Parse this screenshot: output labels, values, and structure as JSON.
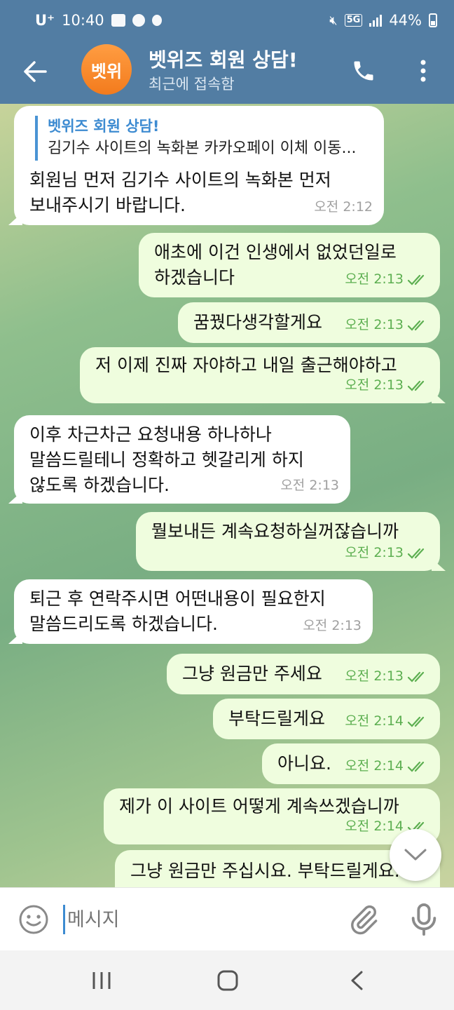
{
  "status_bar": {
    "carrier": "U⁺",
    "time": "10:40",
    "network": "5G",
    "battery": "44%"
  },
  "header": {
    "avatar_text": "벳위",
    "title": "벳위즈 회원 상담!",
    "subtitle": "최근에 접속함"
  },
  "messages": [
    {
      "dir": "in",
      "reply_name": "벳위즈 회원 상담!",
      "reply_text": "김기수 사이트의 녹화본  카카오페이 이체 이동...",
      "lines": [
        "회원님 먼저 김기수 사이트의 녹화본 먼저",
        "보내주시기 바랍니다."
      ],
      "time": "오전 2:12"
    },
    {
      "dir": "out",
      "lines": [
        "애초에 이건 인생에서 없었던일로",
        "하겠습니다"
      ],
      "time": "오전 2:13"
    },
    {
      "dir": "out",
      "lines": [
        "꿈꿨다생각할게요"
      ],
      "time": "오전 2:13"
    },
    {
      "dir": "out",
      "lines": [
        "저 이제 진짜 자야하고 내일 출근해야하고"
      ],
      "time": "오전 2:13"
    },
    {
      "dir": "in",
      "lines": [
        "이후 차근차근 요청내용 하나하나",
        "말씀드릴테니 정확하고 헷갈리게 하지",
        "않도록 하겠습니다."
      ],
      "time": "오전 2:13"
    },
    {
      "dir": "out",
      "lines": [
        "뭘보내든 계속요청하실꺼잖습니까"
      ],
      "time": "오전 2:13"
    },
    {
      "dir": "in",
      "lines": [
        "퇴근 후 연락주시면 어떤내용이 필요한지",
        "말씀드리도록 하겠습니다."
      ],
      "time": "오전 2:13"
    },
    {
      "dir": "out",
      "lines": [
        "그냥 원금만 주세요"
      ],
      "time": "오전 2:13"
    },
    {
      "dir": "out",
      "lines": [
        "부탁드릴게요"
      ],
      "time": "오전 2:14"
    },
    {
      "dir": "out",
      "lines": [
        "아니요."
      ],
      "time": "오전 2:14"
    },
    {
      "dir": "out",
      "lines": [
        "제가 이 사이트 어떻게 계속쓰겠습니까"
      ],
      "time": "오전 2:14"
    },
    {
      "dir": "out",
      "lines": [
        "그냥 원금만 주십시요. 부탁드릴게요."
      ],
      "time": ""
    }
  ],
  "input": {
    "placeholder": "메시지"
  },
  "colors": {
    "header": "#527da3",
    "bubble_out": "#effdde",
    "bubble_in": "#ffffff",
    "time_out": "#5daf51",
    "accent": "#3d8bd1"
  },
  "icons": {
    "back": "arrow-left-icon",
    "call": "phone-icon",
    "more": "more-vertical-icon",
    "emoji": "smile-icon",
    "attach": "paperclip-icon",
    "mic": "microphone-icon",
    "scroll": "chevron-down-icon"
  }
}
